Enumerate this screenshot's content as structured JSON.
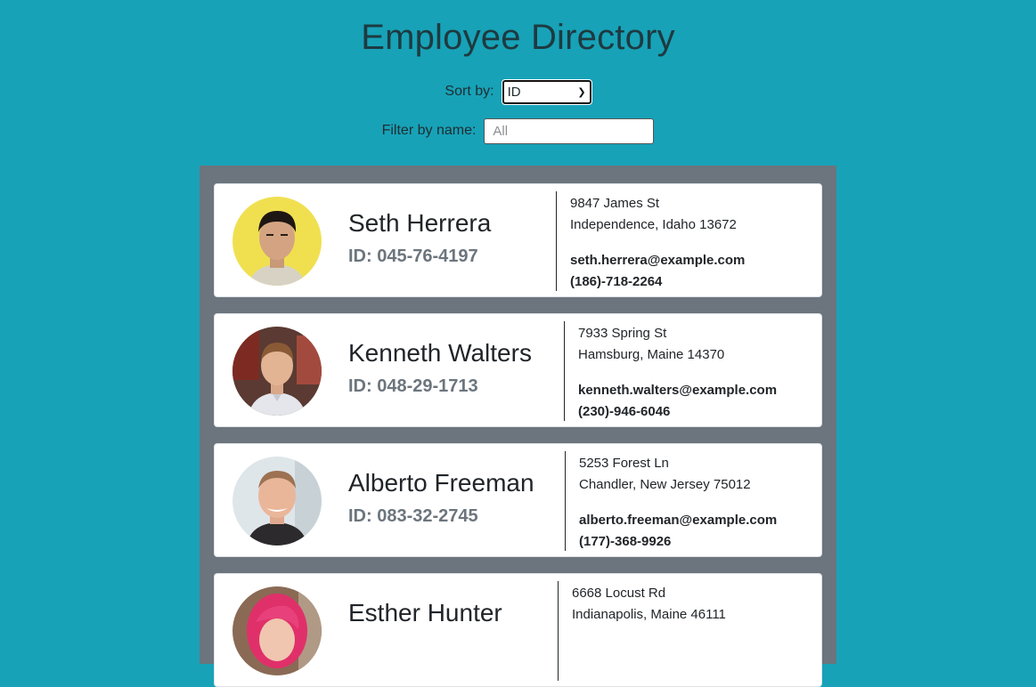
{
  "header": {
    "title": "Employee Directory"
  },
  "controls": {
    "sort_label": "Sort by:",
    "sort_value": "ID",
    "filter_label": "Filter by name:",
    "filter_placeholder": "All",
    "filter_value": ""
  },
  "employees": [
    {
      "name": "Seth Herrera",
      "id": "ID: 045-76-4197",
      "street": "9847 James St",
      "city": "Independence, Idaho 13672",
      "email": "seth.herrera@example.com",
      "phone": "(186)-718-2264",
      "avatar_bg": "#f0e050"
    },
    {
      "name": "Kenneth Walters",
      "id": "ID: 048-29-1713",
      "street": "7933 Spring St",
      "city": "Hamsburg, Maine 14370",
      "email": "kenneth.walters@example.com",
      "phone": "(230)-946-6046",
      "avatar_bg": "#5a3a32"
    },
    {
      "name": "Alberto Freeman",
      "id": "ID: 083-32-2745",
      "street": "5253 Forest Ln",
      "city": "Chandler, New Jersey 75012",
      "email": "alberto.freeman@example.com",
      "phone": "(177)-368-9926",
      "avatar_bg": "#dfe6ea"
    },
    {
      "name": "Esther Hunter",
      "id": "",
      "street": "6668 Locust Rd",
      "city": "Indianapolis, Maine 46111",
      "email": "",
      "phone": "",
      "avatar_bg": "#8a6a55"
    }
  ]
}
